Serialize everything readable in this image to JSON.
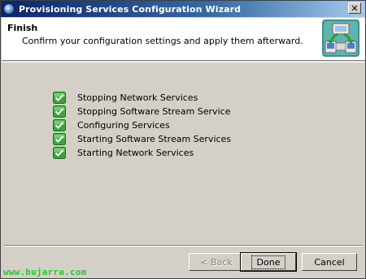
{
  "window": {
    "title": "Provisioning Services Configuration Wizard",
    "close_glyph": "✕"
  },
  "header": {
    "title": "Finish",
    "subtitle": "Confirm your configuration settings and apply them afterward.",
    "logo_icon": "provisioning-wizard-icon"
  },
  "steps": [
    {
      "label": "Stopping Network Services",
      "status": "done",
      "icon": "check-icon"
    },
    {
      "label": "Stopping Software Stream Service",
      "status": "done",
      "icon": "check-icon"
    },
    {
      "label": "Configuring Services",
      "status": "done",
      "icon": "check-icon"
    },
    {
      "label": "Starting Software Stream Services",
      "status": "done",
      "icon": "check-icon"
    },
    {
      "label": "Starting Network Services",
      "status": "done",
      "icon": "check-icon"
    }
  ],
  "buttons": {
    "back": "< Back",
    "done": "Done",
    "cancel": "Cancel"
  },
  "watermark": "www.bujarra.com",
  "colors": {
    "titlebar": "#0a246a",
    "dialog_bg": "#d4d0c8",
    "check_green": "#3aa63a",
    "watermark": "#22cc22"
  }
}
